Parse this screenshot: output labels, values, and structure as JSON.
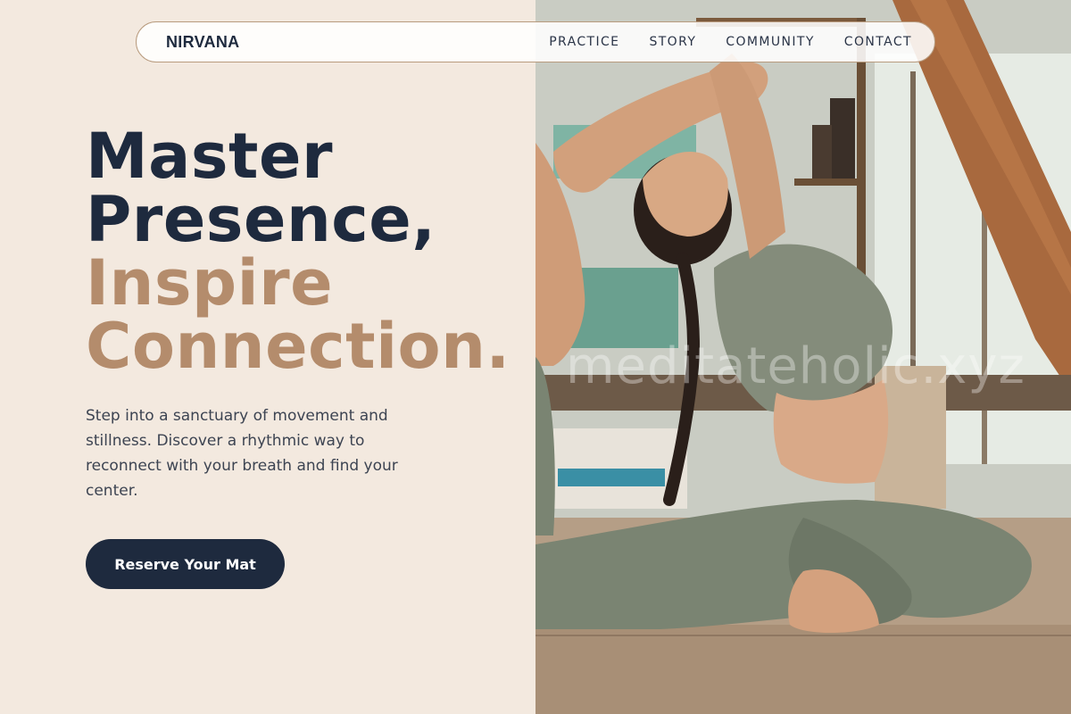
{
  "nav": {
    "brand": "NIRVANA",
    "items": [
      {
        "label": "PRACTICE"
      },
      {
        "label": "STORY"
      },
      {
        "label": "COMMUNITY"
      },
      {
        "label": "CONTACT"
      }
    ]
  },
  "hero": {
    "headline_line1": "Master",
    "headline_line2": "Presence,",
    "headline_line3": "Inspire",
    "headline_line4": "Connection.",
    "description": "Step into a sanctuary of movement and stillness. Discover a rhythmic way to reconnect with your breath and find your center.",
    "cta_label": "Reserve Your Mat"
  },
  "image": {
    "watermark": "meditateholic.xyz"
  },
  "colors": {
    "background": "#f3e9df",
    "navy": "#1e2a3e",
    "accent": "#b48c6c",
    "body_text": "#3d4452"
  }
}
